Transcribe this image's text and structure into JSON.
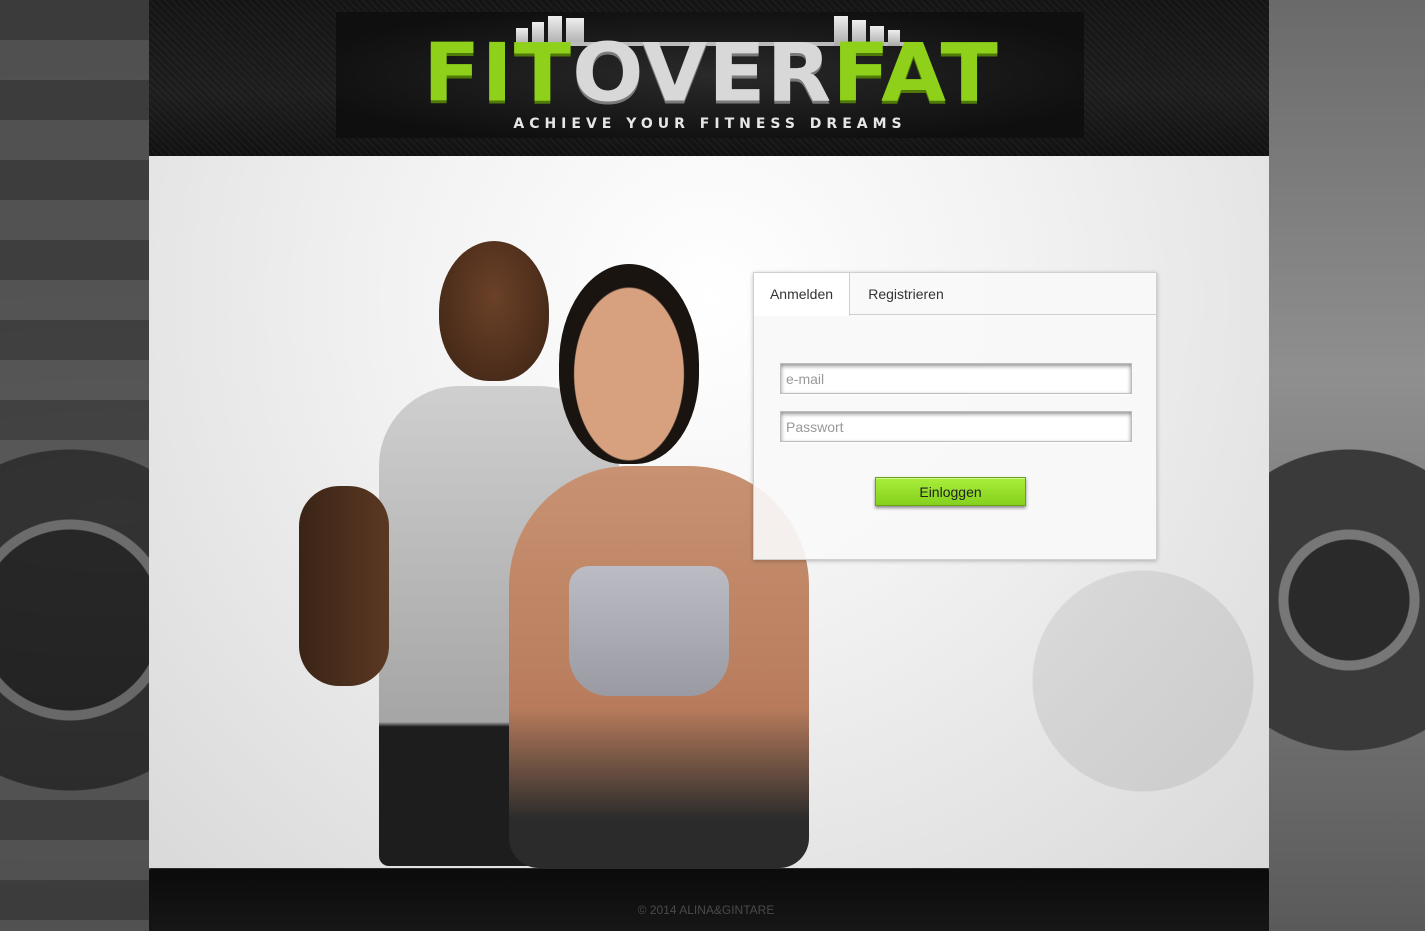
{
  "brand": {
    "logo_part1": "FIT",
    "logo_part2": "OVER",
    "logo_part3": "FAT",
    "tagline": "ACHIEVE YOUR FITNESS DREAMS",
    "accent_color": "#8fd11a"
  },
  "login": {
    "tabs": [
      {
        "label": "Anmelden",
        "active": true
      },
      {
        "label": "Registrieren",
        "active": false
      }
    ],
    "email_placeholder": "e-mail",
    "password_placeholder": "Passwort",
    "submit_label": "Einloggen"
  },
  "footer": {
    "copyright": "© 2014 ALINA&GINTARE"
  }
}
